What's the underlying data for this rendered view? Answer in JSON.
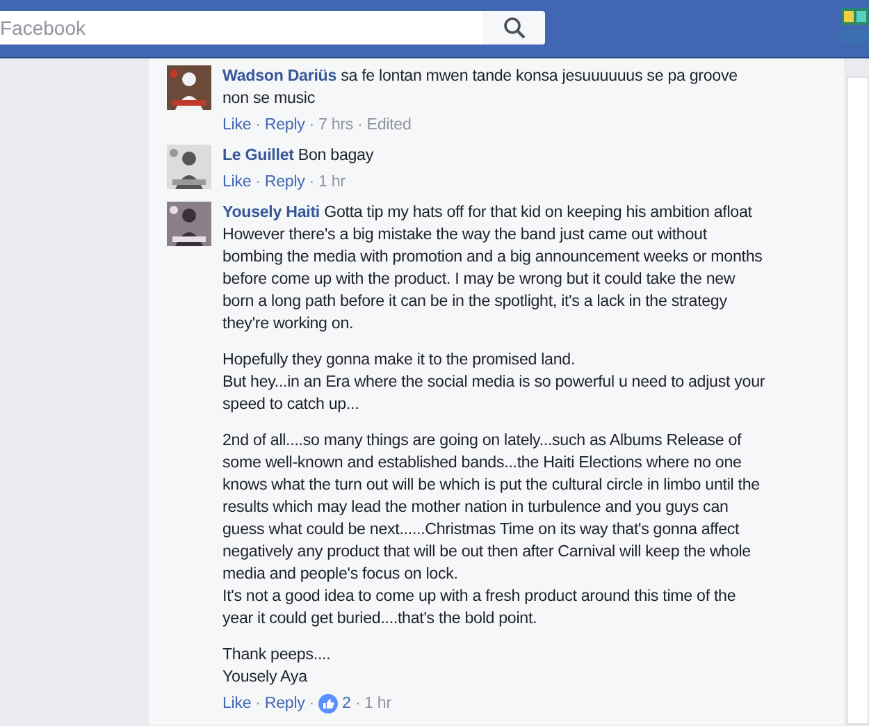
{
  "top_bar": {
    "search": {
      "placeholder": "Facebook"
    }
  },
  "separator": "·",
  "comments": [
    {
      "author": "Wadson Dariüs",
      "avatar": {
        "kind": "picture"
      },
      "paragraphs": [
        [
          "sa fe lontan mwen tande konsa jesuuuuuus se pa groove non se music"
        ]
      ],
      "actions": [
        "Like",
        "Reply"
      ],
      "time": "7 hrs",
      "edited": "Edited"
    },
    {
      "author": "Le Guillet",
      "avatar": {
        "kind": "picture"
      },
      "paragraphs": [
        [
          "Bon bagay"
        ]
      ],
      "actions": [
        "Like",
        "Reply"
      ],
      "time": "1 hr"
    },
    {
      "author": "Yousely Haiti",
      "avatar": {
        "kind": "picture"
      },
      "paragraphs": [
        [
          "Gotta tip my hats off for that kid on keeping his ambition afloat",
          "However there's a big mistake the way the band just came out without bombing the media with promotion and a big announcement weeks or months before come up with the product. I may be wrong but it could take the new born a long path before it can be in the spotlight, it's a lack in the strategy they're working on."
        ],
        [
          "Hopefully they gonna make it to the promised land.",
          "But hey...in an Era where the social media is so powerful u need to adjust your speed to catch up..."
        ],
        [
          "2nd of all....so many things are going on lately...such as Albums Release of some well-known and established bands...the Haiti Elections where no one knows what the turn out will be which is put the cultural circle in limbo until the results which may lead the mother nation in turbulence and you guys can guess what could be next......Christmas Time on its way that's gonna affect negatively any product that will be out then after Carnival will keep the whole media and people's focus on lock.",
          "It's not a good idea to come up with a fresh product around this time of the year it could get buried....that's the bold point."
        ],
        [
          "Thank peeps....",
          "Yousely Aya"
        ]
      ],
      "actions": [
        "Like",
        "Reply"
      ],
      "likes": "2",
      "time": "1 hr"
    }
  ]
}
